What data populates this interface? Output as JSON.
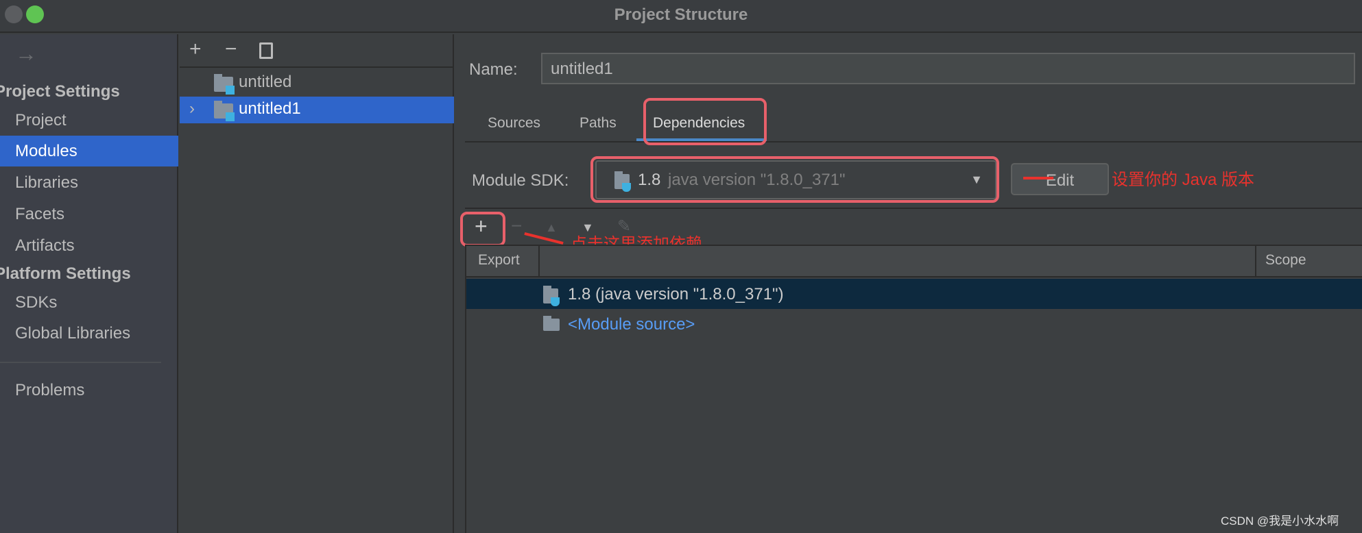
{
  "window": {
    "title": "Project Structure"
  },
  "sidebar": {
    "back_icon": "arrow-right-icon",
    "project_settings_header": "Project Settings",
    "items": [
      {
        "label": "Project"
      },
      {
        "label": "Modules",
        "selected": true
      },
      {
        "label": "Libraries"
      },
      {
        "label": "Facets"
      },
      {
        "label": "Artifacts"
      }
    ],
    "platform_settings_header": "Platform Settings",
    "platform_items": [
      {
        "label": "SDKs"
      },
      {
        "label": "Global Libraries"
      }
    ],
    "problems": "Problems"
  },
  "modules_panel": {
    "toolbar": [
      "add-icon",
      "remove-icon",
      "copy-icon"
    ],
    "tree": [
      {
        "label": "untitled"
      },
      {
        "label": "untitled1",
        "selected": true
      }
    ]
  },
  "module": {
    "name_label": "Name:",
    "name_value": "untitled1",
    "tabs": [
      {
        "label": "Sources"
      },
      {
        "label": "Paths"
      },
      {
        "label": "Dependencies",
        "active": true
      }
    ],
    "sdk_label": "Module SDK:",
    "sdk_version": "1.8",
    "sdk_detail": "java version \"1.8.0_371\"",
    "edit_label": "Edit",
    "table": {
      "headers": [
        "Export",
        "",
        "Scope"
      ],
      "rows": [
        {
          "label": "1.8 (java version \"1.8.0_371\")",
          "selected": true
        },
        {
          "label": "<Module source>"
        }
      ]
    }
  },
  "annotations": {
    "sdk_note": "设置你的 Java 版本",
    "add_note": "点击这里添加依赖",
    "color": "#e8322d"
  },
  "watermark": "CSDN @我是小水水啊",
  "colors": {
    "selection": "#2f65ca",
    "table_selection": "#0d293e",
    "link": "#589df6"
  }
}
